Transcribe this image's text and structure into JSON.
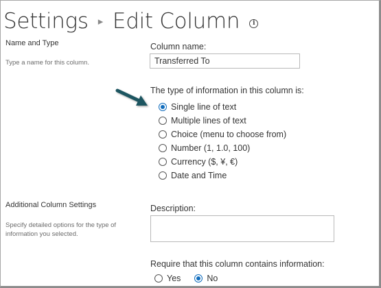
{
  "header": {
    "breadcrumb_root": "Settings",
    "separator": "▸",
    "page_title": "Edit Column",
    "info_icon_glyph": "i"
  },
  "sections": {
    "name_type": {
      "title": "Name and Type",
      "description": "Type a name for this column."
    },
    "additional": {
      "title": "Additional Column Settings",
      "description_line1": "Specify detailed options for the type of",
      "description_line2": "information you selected."
    }
  },
  "column_name": {
    "label": "Column name:",
    "value": "Transferred To"
  },
  "type_question": "The type of information in this column is:",
  "type_options": [
    {
      "label": "Single line of text",
      "selected": true
    },
    {
      "label": "Multiple lines of text",
      "selected": false
    },
    {
      "label": "Choice (menu to choose from)",
      "selected": false
    },
    {
      "label": "Number (1, 1.0, 100)",
      "selected": false
    },
    {
      "label": "Currency ($, ¥, €)",
      "selected": false
    },
    {
      "label": "Date and Time",
      "selected": false
    }
  ],
  "description_field": {
    "label": "Description:",
    "value": ""
  },
  "required": {
    "question": "Require that this column contains information:",
    "options": [
      {
        "label": "Yes",
        "selected": false
      },
      {
        "label": "No",
        "selected": true
      }
    ]
  },
  "colors": {
    "accent": "#0f6cbd",
    "annotation_arrow": "#1f5560",
    "text": "#333333",
    "muted_text": "#6b6b6b"
  }
}
